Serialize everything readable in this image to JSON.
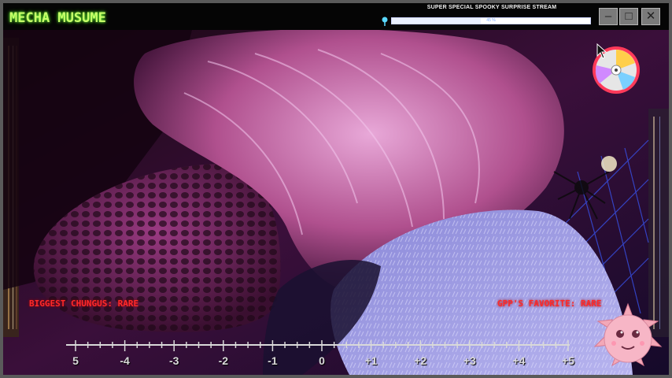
{
  "app": {
    "logo_text": "MECHA MUSUME"
  },
  "header": {
    "stream_title": "SUPER SPECIAL SPOOKY SURPRISE STREAM",
    "progress_text": "45 %",
    "progress_fraction": 0.45
  },
  "window_controls": {
    "minimize": "–",
    "maximize": "□",
    "close": "✕"
  },
  "captions": {
    "left": "BIGGEST CHUNGUS: RARE",
    "right": "GPP'S FAVORITE: RARE"
  },
  "ruler": {
    "labels": [
      "5",
      "-4",
      "-3",
      "-2",
      "-1",
      "0",
      "+1",
      "+2",
      "+3",
      "+4",
      "+5"
    ]
  },
  "icons": {
    "pin": "pin-icon",
    "disc": "cd-icon",
    "cursor": "cursor-icon",
    "mascot": "spiky-ball-icon"
  },
  "colors": {
    "logo": "#c8ff6a",
    "caption": "#ff2a2a",
    "frame": "#5a5a5a"
  }
}
